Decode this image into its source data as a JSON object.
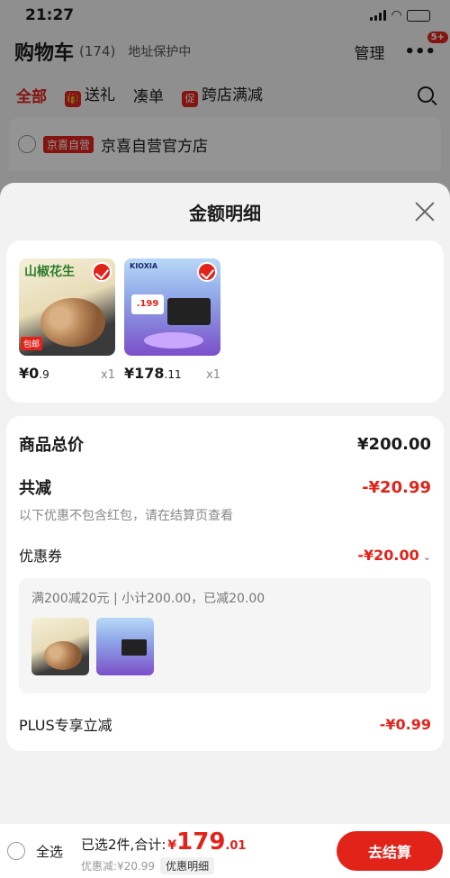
{
  "status_bar": {
    "time": "21:27"
  },
  "cart_header": {
    "title": "购物车",
    "count": "(174)",
    "address": "地址保护中",
    "manage": "管理",
    "badge": "5+"
  },
  "tabs": [
    {
      "label": "全部"
    },
    {
      "label": "送礼"
    },
    {
      "label": "凑单"
    },
    {
      "label": "跨店满减"
    }
  ],
  "shop": {
    "tag": "京喜自营",
    "name": "京喜自营官方店"
  },
  "sheet": {
    "title": "金额明细",
    "products": [
      {
        "name_overlay": "山椒花生",
        "badge": "包邮",
        "price_main": "¥0",
        "price_decimal": ".9",
        "qty": "x1"
      },
      {
        "name_overlay": "KIOXIA",
        "price_tag": ".199",
        "price_main": "¥178",
        "price_decimal": ".11",
        "qty": "x1"
      }
    ],
    "total_label": "商品总价",
    "total_value": "¥200.00",
    "discount_label": "共减",
    "discount_value": "-¥20.99",
    "discount_note": "以下优惠不包含红包，请在结算页查看",
    "coupon_label": "优惠券",
    "coupon_value": "-¥20.00",
    "coupon_detail": "满200减20元 | 小计200.00，已减20.00",
    "plus_label": "PLUS专享立减",
    "plus_value": "-¥0.99"
  },
  "bottom_bar": {
    "select_all": "全选",
    "selected_text": "已选2件,合计:",
    "total_yen": "¥",
    "total_main": "179",
    "total_decimal": ".01",
    "discount_text": "优惠减:¥20.99",
    "detail_chip": "优惠明细",
    "checkout": "去结算"
  },
  "colors": {
    "accent": "#e2231a"
  }
}
